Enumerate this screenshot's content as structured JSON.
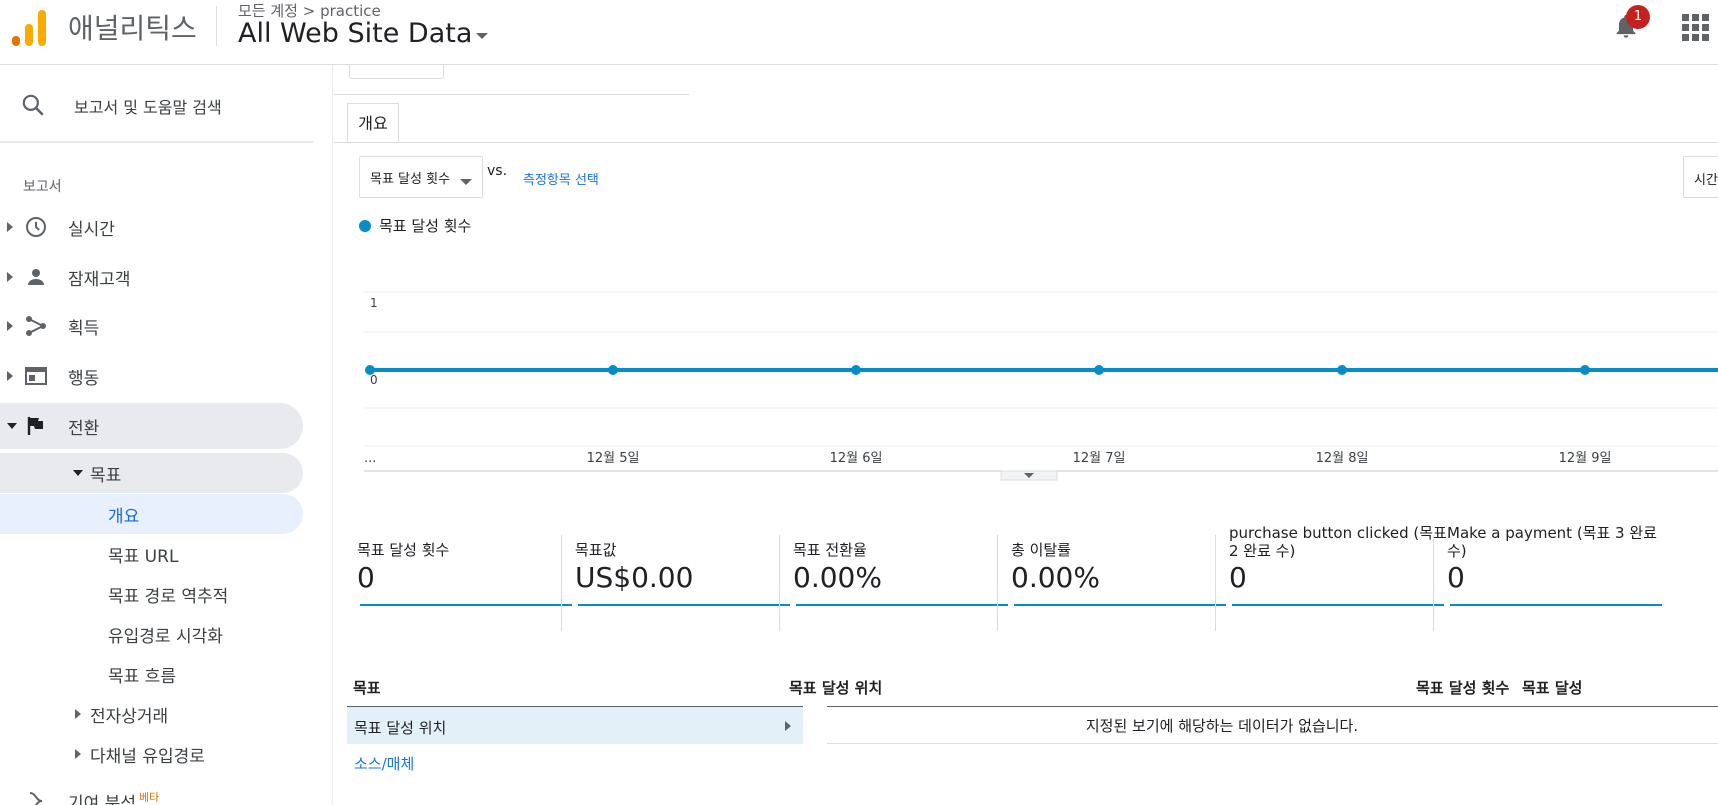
{
  "brand": {
    "name": "애널리틱스",
    "colors": [
      "#f9ab00",
      "#e37400"
    ]
  },
  "breadcrumb": {
    "parent": "모든 계정",
    "child": "practice"
  },
  "property": {
    "name": "All Web Site Data"
  },
  "notifications": {
    "count": "1"
  },
  "sidebar": {
    "search_label": "보고서 및 도움말 검색",
    "section": "보고서",
    "items": [
      {
        "label": "실시간",
        "icon": "clock-icon"
      },
      {
        "label": "잠재고객",
        "icon": "person-icon"
      },
      {
        "label": "획득",
        "icon": "acquisition-icon"
      },
      {
        "label": "행동",
        "icon": "behavior-icon"
      },
      {
        "label": "전환",
        "icon": "flag-icon"
      }
    ],
    "goals": {
      "label": "목표",
      "children": [
        "개요",
        "목표 URL",
        "목표 경로 역추적",
        "유입경로 시각화",
        "목표 흐름"
      ]
    },
    "more": [
      "전자상거래",
      "다채널 유입경로"
    ],
    "attribution": {
      "label": "기여 분석",
      "badge": "베타"
    }
  },
  "main": {
    "tab": "개요",
    "metric_select": "목표 달성 횟수",
    "vs": "vs.",
    "choose_metric": "측정항목 선택",
    "time_button": "시간",
    "legend": "목표 달성 횟수"
  },
  "chart_data": {
    "type": "line",
    "categories": [
      "...",
      "12월 5일",
      "12월 6일",
      "12월 7일",
      "12월 8일",
      "12월 9일"
    ],
    "series": [
      {
        "name": "목표 달성 횟수",
        "values": [
          0,
          0,
          0,
          0,
          0,
          0,
          0
        ]
      }
    ],
    "y_ticks": [
      "1",
      "0"
    ],
    "ylim": [
      0,
      1
    ],
    "color": "#058dc7"
  },
  "kpis": [
    {
      "title": "목표 달성 횟수",
      "value": "0"
    },
    {
      "title": "목표값",
      "value": "US$0.00"
    },
    {
      "title": "목표 전환율",
      "value": "0.00%"
    },
    {
      "title": "총 이탈률",
      "value": "0.00%"
    },
    {
      "title": "purchase button clicked (목표 2 완료 수)",
      "value": "0"
    },
    {
      "title": "Make a payment (목표 3 완료 수)",
      "value": "0"
    }
  ],
  "table": {
    "left_header": "목표",
    "left_row": "목표 달성 위치",
    "left_link": "소스/매체",
    "right_header": "목표 달성 위치",
    "col1": "목표 달성 횟수",
    "col2": "목표 달성",
    "no_data": "지정된 보기에 해당하는 데이터가 없습니다."
  }
}
